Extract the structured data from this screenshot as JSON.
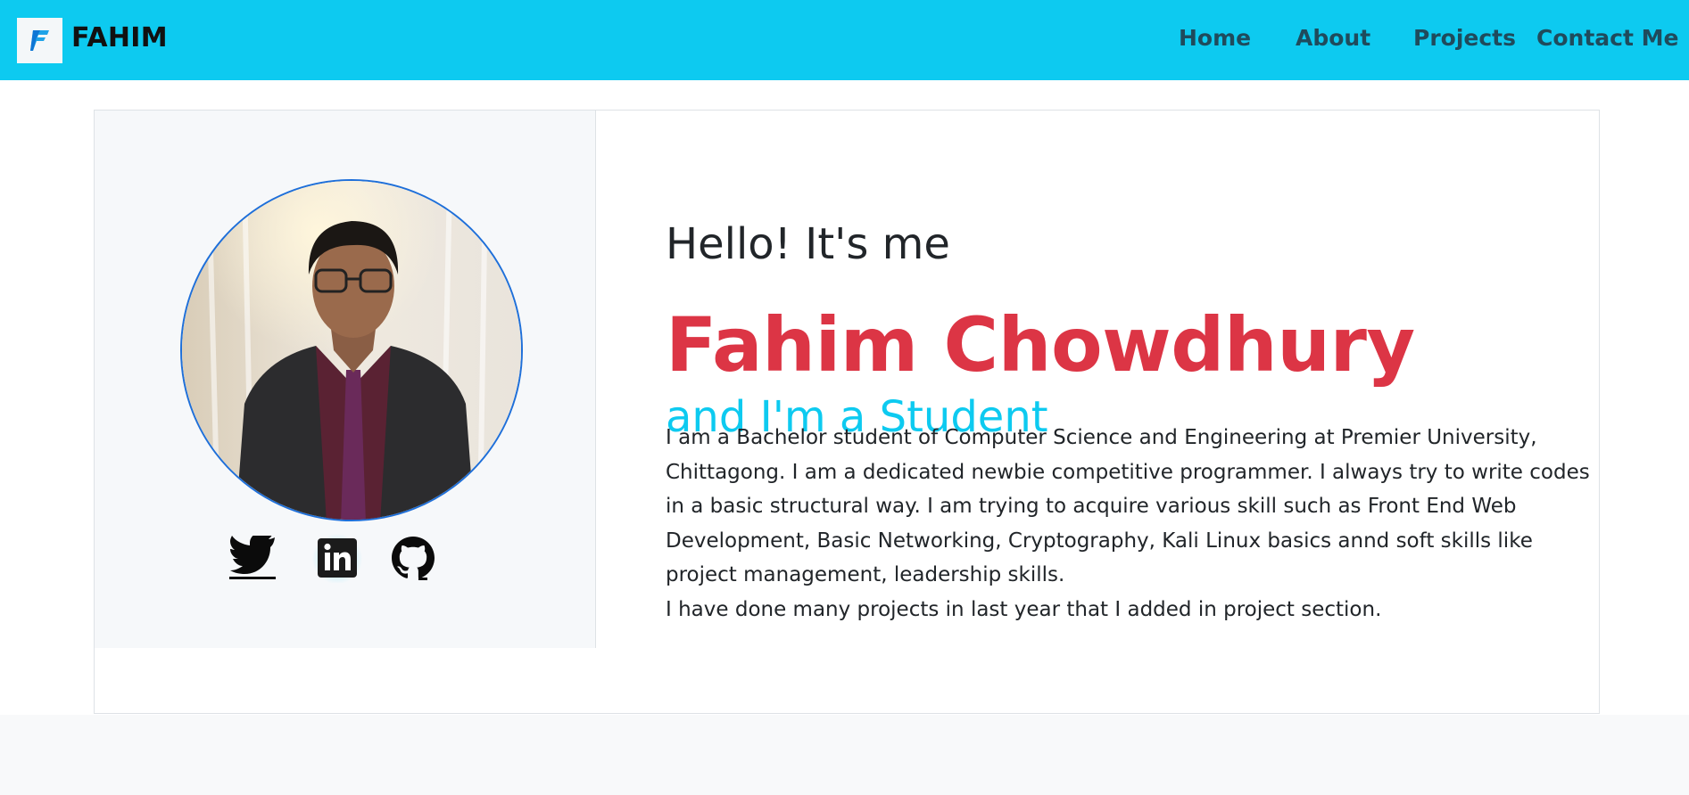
{
  "brand": {
    "name": "FAHIM",
    "logo_letter": "F"
  },
  "nav": {
    "items": [
      {
        "label": "Home"
      },
      {
        "label": "About"
      },
      {
        "label": "Projects"
      },
      {
        "label": "Contact Me"
      }
    ]
  },
  "hero": {
    "greeting": "Hello! It's me",
    "name": "Fahim Chowdhury",
    "role": "and I'm a Student",
    "bio": [
      "I am a Bachelor student of Computer Science and Engineering at Premier University, Chittagong. I am a dedicated newbie competitive programmer. I always try to write codes in a basic structural way. I am trying to acquire various skill such as Front End Web Development, Basic Networking, Cryptography, Kali Linux basics annd soft skills like project management, leadership skills.",
      "I have done many projects in last year that I added in project section."
    ]
  },
  "social": [
    {
      "icon": "twitter-icon"
    },
    {
      "icon": "linkedin-icon"
    },
    {
      "icon": "github-icon"
    }
  ],
  "colors": {
    "navbar": "#0dcaf0",
    "name": "#dc3545",
    "role": "#0dcaf0",
    "avatar_border": "#1e6fd9"
  }
}
